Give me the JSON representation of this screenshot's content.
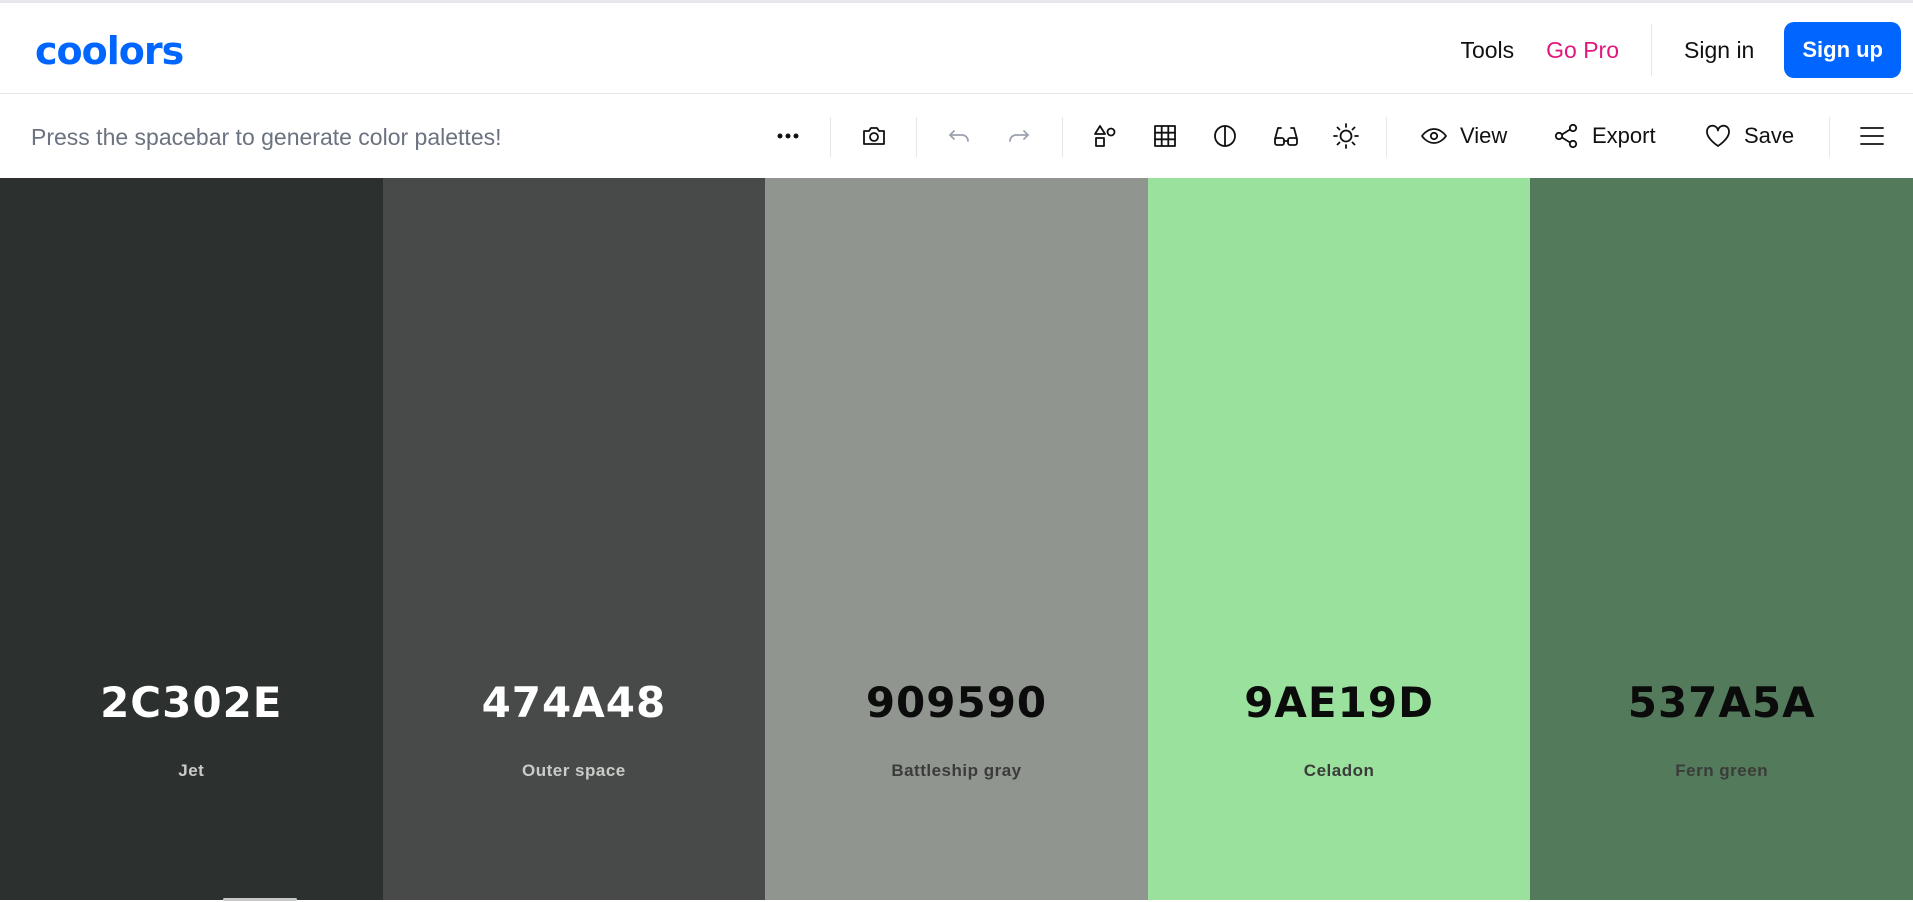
{
  "brand": {
    "logo_text": "coolors",
    "accent": "#0066ff",
    "pro_color": "#e2177d"
  },
  "nav": {
    "tools": "Tools",
    "go_pro": "Go Pro",
    "sign_in": "Sign in",
    "sign_up": "Sign up"
  },
  "toolbar": {
    "hint": "Press the spacebar to generate color palettes!",
    "icons": [
      "more-icon",
      "camera-icon",
      "undo-icon",
      "redo-icon",
      "shapes-icon",
      "grid-icon",
      "contrast-icon",
      "glasses-icon",
      "sun-icon",
      "eye-icon",
      "share-icon",
      "heart-icon",
      "menu-icon"
    ],
    "view_label": "View",
    "export_label": "Export",
    "save_label": "Save"
  },
  "palette": {
    "colors": [
      {
        "hex": "2C302E",
        "name": "Jet",
        "color": "#2C302E",
        "text": "light"
      },
      {
        "hex": "474A48",
        "name": "Outer space",
        "color": "#474A48",
        "text": "light"
      },
      {
        "hex": "909590",
        "name": "Battleship gray",
        "color": "#909590",
        "text": "dark"
      },
      {
        "hex": "9AE19D",
        "name": "Celadon",
        "color": "#9AE19D",
        "text": "dark"
      },
      {
        "hex": "537A5A",
        "name": "Fern green",
        "color": "#537A5A",
        "text": "dark"
      }
    ]
  }
}
